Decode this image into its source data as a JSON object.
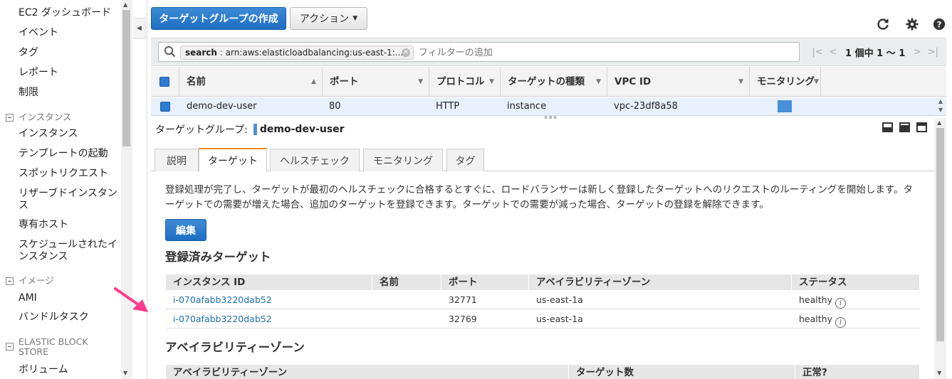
{
  "sidebar": {
    "items": [
      {
        "label": "EC2 ダッシュボード"
      },
      {
        "label": "イベント"
      },
      {
        "label": "タグ"
      },
      {
        "label": "レポート"
      },
      {
        "label": "制限"
      },
      {
        "label": "インスタンス"
      },
      {
        "label": "テンプレートの起動"
      },
      {
        "label": "スポットリクエスト"
      },
      {
        "label": "リザーブドインスタンス"
      },
      {
        "label": "専有ホスト"
      },
      {
        "label": "スケジュールされたインスタンス"
      },
      {
        "label": "AMI"
      },
      {
        "label": "バンドルタスク"
      },
      {
        "label": "ボリューム"
      }
    ],
    "sections": [
      {
        "label": "インスタンス"
      },
      {
        "label": "イメージ"
      },
      {
        "label": "ELASTIC BLOCK STORE"
      }
    ]
  },
  "toolbar": {
    "create_label": "ターゲットグループの作成",
    "action_label": "アクション",
    "icons": [
      "refresh-icon",
      "gear-icon",
      "help-icon"
    ]
  },
  "filter": {
    "token_key": "search",
    "token_value": "arn:aws:elasticloadbalancing:us-east-1:...",
    "placeholder": "フィルターの追加",
    "pager_text": "1 個中 1 〜 1"
  },
  "grid": {
    "columns": [
      "名前",
      "ポート",
      "プロトコル",
      "ターゲットの種類",
      "VPC ID",
      "モニタリング"
    ],
    "row": {
      "name": "demo-dev-user",
      "port": "80",
      "protocol": "HTTP",
      "target_type": "instance",
      "vpc_id": "vpc-23df8a58"
    }
  },
  "detail": {
    "title_prefix": "ターゲットグループ:",
    "title_name": "demo-dev-user",
    "tabs": [
      "説明",
      "ターゲット",
      "ヘルスチェック",
      "モニタリング",
      "タグ"
    ],
    "active_tab": "ターゲット",
    "description": "登録処理が完了し、ターゲットが最初のヘルスチェックに合格するとすぐに、ロードバランサーは新しく登録したターゲットへのリクエストのルーティングを開始します。ターゲットでの需要が増えた場合、追加のターゲットを登録できます。ターゲットでの需要が減った場合、ターゲットの登録を解除できます。",
    "edit_label": "編集",
    "registered": {
      "heading": "登録済みターゲット",
      "columns": [
        "インスタンス ID",
        "名前",
        "ポート",
        "アベイラビリティーゾーン",
        "ステータス"
      ],
      "rows": [
        {
          "instance_id": "i-070afabb3220dab52",
          "name": "",
          "port": "32771",
          "az": "us-east-1a",
          "status": "healthy"
        },
        {
          "instance_id": "i-070afabb3220dab52",
          "name": "",
          "port": "32769",
          "az": "us-east-1a",
          "status": "healthy"
        }
      ]
    },
    "az": {
      "heading": "アベイラビリティーゾーン",
      "columns": [
        "アベイラビリティーゾーン",
        "ターゲット数",
        "正常?"
      ]
    }
  },
  "colors": {
    "primary_button": "#1e6ec2",
    "active_tab_accent": "#e88d1a",
    "link": "#1f6fb2",
    "annotation_arrow": "#ff3c8c"
  }
}
